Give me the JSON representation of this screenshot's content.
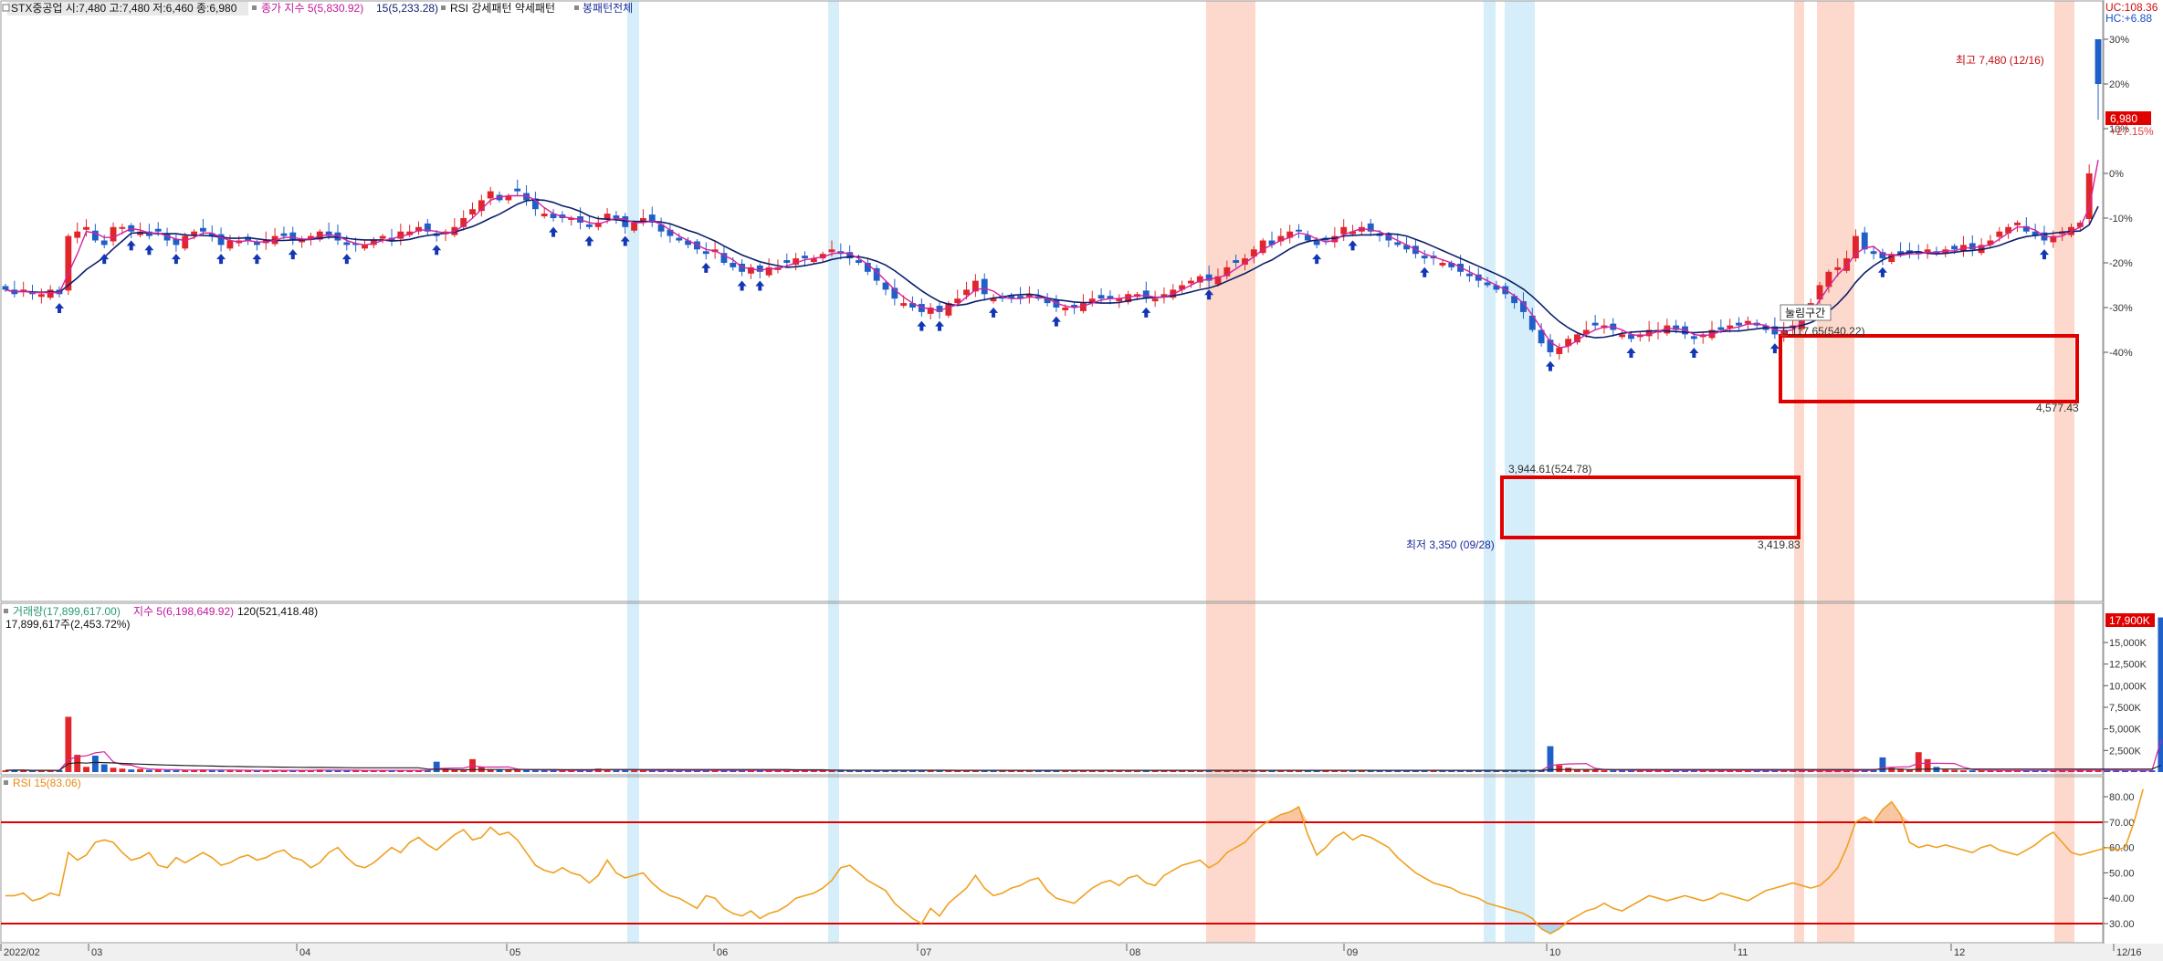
{
  "legend": {
    "price": {
      "stock_info": "STX중공업 시:7,480 고:7,480 저:6,460 종:6,980",
      "ma5": "종가 지수 5(5,830.92)",
      "ma15": "15(5,233.28)",
      "rsi_pattern": "RSI 강세패턴  약세패턴",
      "pattern_all": "봉패턴전체"
    },
    "volume": {
      "volume": "거래량(17,899,617.00)",
      "vma5": "지수 5(6,198,649.92)",
      "vma120": "120(521,418.48)",
      "volume_sub": "17,899,617주(2,453.72%)"
    },
    "rsi": {
      "label": "RSI 15(83.06)"
    }
  },
  "annotations": {
    "high": "최고 7,480 (12/16)",
    "low": "최저 3,350 (09/28)",
    "box2_top": "5,117.65(540.22)",
    "box2_bottom": "4,577.43",
    "box1_top": "3,944.61(524.78)",
    "box1_bottom": "3,419.83",
    "breakout_tag": "눌림구간"
  },
  "right_labels": {
    "uc": "UC:108.36",
    "hc": "HC:+6.88",
    "price": "6,980",
    "price_sub": "+27.15%",
    "volume": "17,900K"
  },
  "colors": {
    "up": "#e0262b",
    "down": "#1f5fc8",
    "ma5": "#d6219e",
    "ma15": "#0c1f6b",
    "rsi": "#f0a020",
    "signal": "#1236b4",
    "band_red": "#fcd9cc",
    "band_blue": "#d5eef9",
    "box": "#e00000"
  },
  "chart_data": {
    "type": "candlestick",
    "ticker": "STX중공업",
    "date_range": [
      "2022/02",
      "12/16"
    ],
    "x_tick_labels": [
      "2022/02",
      "03",
      "04",
      "05",
      "06",
      "07",
      "08",
      "09",
      "10",
      "11",
      "12",
      "12/16"
    ],
    "price_axis_ticks": [
      "30%",
      "20%",
      "10%",
      "0%",
      "-10%",
      "-20%",
      "-30%",
      "-40%"
    ],
    "price_axis_values": [
      30,
      20,
      10,
      0,
      -10,
      -20,
      -30,
      -40
    ],
    "volume_axis_ticks": [
      "15,000K",
      "12,500K",
      "10,000K",
      "7,500K",
      "5,000K",
      "2,500K"
    ],
    "volume_axis_values": [
      15000,
      12500,
      10000,
      7500,
      5000,
      2500
    ],
    "rsi_axis_ticks": [
      "80.00",
      "70.00",
      "60.00",
      "50.00",
      "40.00",
      "30.00"
    ],
    "rsi_axis_values": [
      80,
      70,
      60,
      50,
      40,
      30
    ],
    "rsi_levels": [
      70,
      30
    ],
    "last": {
      "open": 7480,
      "high": 7480,
      "low": 6460,
      "close": 6980,
      "volume": 17899617,
      "rsi": 83.06
    },
    "close_pct": [
      -26,
      -27,
      -26,
      -27,
      -27,
      -26,
      -27,
      -14,
      -13,
      -12,
      -15,
      -16,
      -12,
      -12,
      -13,
      -13,
      -14,
      -13,
      -15,
      -16,
      -14,
      -13,
      -13,
      -14,
      -16,
      -15,
      -15,
      -15,
      -16,
      -15,
      -14,
      -14,
      -15,
      -15,
      -14,
      -13,
      -14,
      -15,
      -16,
      -16,
      -16,
      -15,
      -14,
      -15,
      -13,
      -13,
      -12,
      -13,
      -14,
      -13,
      -12,
      -10,
      -8,
      -6,
      -4,
      -6,
      -5,
      -4,
      -6,
      -8,
      -9,
      -10,
      -10,
      -10,
      -11,
      -12,
      -11,
      -9,
      -10,
      -12,
      -11,
      -10,
      -11,
      -13,
      -14,
      -15,
      -16,
      -17,
      -18,
      -17,
      -20,
      -21,
      -22,
      -21,
      -22,
      -21,
      -21,
      -20,
      -19,
      -19,
      -19,
      -18,
      -17,
      -18,
      -19,
      -20,
      -22,
      -24,
      -26,
      -28,
      -29,
      -30,
      -31,
      -30,
      -31,
      -29,
      -28,
      -26,
      -24,
      -27,
      -28,
      -28,
      -28,
      -28,
      -27,
      -28,
      -29,
      -30,
      -30,
      -30,
      -29,
      -28,
      -28,
      -28,
      -28,
      -27,
      -27,
      -28,
      -28,
      -27,
      -26,
      -25,
      -24,
      -23,
      -24,
      -23,
      -21,
      -20,
      -19,
      -17,
      -15,
      -16,
      -14,
      -13,
      -13,
      -15,
      -16,
      -15,
      -14,
      -12,
      -13,
      -12,
      -13,
      -14,
      -15,
      -16,
      -17,
      -18,
      -19,
      -19,
      -20,
      -21,
      -22,
      -23,
      -24,
      -25,
      -26,
      -27,
      -29,
      -31,
      -35,
      -38,
      -40,
      -39,
      -37,
      -36,
      -35,
      -34,
      -34,
      -35,
      -36,
      -37,
      -36,
      -35,
      -35,
      -34,
      -35,
      -36,
      -37,
      -36,
      -35,
      -35,
      -34,
      -34,
      -33,
      -34,
      -35,
      -36,
      -35,
      -34,
      -31,
      -29,
      -25,
      -22,
      -21,
      -19,
      -14,
      -17,
      -18,
      -19,
      -18,
      -18,
      -18,
      -18,
      -17,
      -18,
      -17,
      -17,
      -16,
      -17,
      -16,
      -15,
      -13,
      -12,
      -11,
      -13,
      -14,
      -15,
      -14,
      -13,
      -12,
      -11,
      0,
      20
    ],
    "high_pct_last": 30,
    "low_pct_last": 12,
    "volume_k": [
      200,
      250,
      200,
      150,
      180,
      200,
      220,
      6400,
      2000,
      600,
      1900,
      900,
      500,
      400,
      300,
      350,
      250,
      300,
      250,
      200,
      200,
      250,
      300,
      250,
      200,
      200,
      200,
      200,
      200,
      200,
      200,
      200,
      200,
      200,
      200,
      300,
      200,
      200,
      200,
      200,
      200,
      200,
      200,
      200,
      200,
      200,
      200,
      200,
      1200,
      400,
      300,
      200,
      1500,
      600,
      300,
      300,
      300,
      250,
      250,
      200,
      200,
      200,
      200,
      200,
      200,
      200,
      400,
      300,
      200,
      200,
      200,
      200,
      200,
      200,
      200,
      200,
      200,
      200,
      200,
      200,
      200,
      200,
      200,
      200,
      200,
      200,
      200,
      200,
      200,
      200,
      200,
      200,
      200,
      200,
      200,
      200,
      200,
      200,
      200,
      200,
      200,
      200,
      200,
      200,
      200,
      200,
      200,
      200,
      200,
      200,
      200,
      200,
      200,
      200,
      200,
      200,
      200,
      200,
      200,
      200,
      200,
      200,
      200,
      200,
      200,
      200,
      200,
      200,
      200,
      200,
      200,
      200,
      200,
      200,
      200,
      200,
      200,
      200,
      200,
      200,
      200,
      200,
      200,
      200,
      200,
      200,
      200,
      200,
      200,
      200,
      200,
      200,
      200,
      200,
      200,
      200,
      200,
      200,
      200,
      200,
      200,
      200,
      200,
      200,
      200,
      200,
      200,
      200,
      200,
      200,
      200,
      200,
      3000,
      800,
      500,
      300,
      300,
      250,
      200,
      200,
      200,
      200,
      200,
      200,
      200,
      200,
      200,
      200,
      200,
      200,
      200,
      200,
      200,
      200,
      200,
      200,
      200,
      200,
      200,
      200,
      200,
      200,
      200,
      200,
      200,
      200,
      200,
      200,
      200,
      1700,
      500,
      400,
      300,
      2300,
      1500,
      600,
      300,
      250,
      200,
      200,
      200,
      200,
      200,
      200,
      200,
      200,
      200,
      200,
      200,
      200,
      200,
      300,
      200,
      200,
      200,
      200,
      200,
      200,
      200,
      200,
      17900
    ],
    "rsi": [
      41,
      41,
      42,
      39,
      40,
      42,
      41,
      58,
      55,
      57,
      62,
      63,
      62,
      58,
      55,
      56,
      58,
      53,
      52,
      56,
      54,
      56,
      58,
      56,
      53,
      54,
      56,
      57,
      55,
      56,
      58,
      59,
      56,
      55,
      52,
      54,
      58,
      60,
      56,
      53,
      52,
      54,
      57,
      60,
      58,
      62,
      64,
      61,
      59,
      62,
      65,
      67,
      63,
      64,
      68,
      65,
      66,
      63,
      58,
      53,
      51,
      50,
      52,
      50,
      49,
      46,
      49,
      55,
      50,
      48,
      49,
      50,
      46,
      43,
      41,
      40,
      38,
      36,
      41,
      40,
      36,
      34,
      33,
      35,
      32,
      34,
      35,
      37,
      40,
      41,
      42,
      44,
      47,
      52,
      53,
      50,
      47,
      45,
      43,
      38,
      35,
      32,
      30,
      36,
      33,
      38,
      41,
      44,
      49,
      44,
      41,
      42,
      44,
      45,
      47,
      48,
      43,
      40,
      39,
      38,
      41,
      44,
      46,
      47,
      45,
      48,
      49,
      46,
      45,
      49,
      51,
      53,
      54,
      55,
      52,
      54,
      58,
      60,
      62,
      66,
      69,
      71,
      73,
      74,
      76,
      65,
      57,
      60,
      64,
      66,
      63,
      65,
      64,
      62,
      60,
      56,
      53,
      50,
      48,
      46,
      45,
      44,
      42,
      41,
      40,
      38,
      37,
      36,
      35,
      34,
      32,
      28,
      26,
      28,
      31,
      33,
      35,
      36,
      38,
      36,
      35,
      37,
      39,
      41,
      40,
      39,
      40,
      41,
      40,
      39,
      40,
      42,
      41,
      40,
      39,
      41,
      43,
      44,
      45,
      46,
      45,
      44,
      45,
      48,
      52,
      60,
      70,
      72,
      70,
      75,
      78,
      73,
      62,
      60,
      61,
      60,
      61,
      60,
      59,
      58,
      60,
      61,
      59,
      58,
      57,
      59,
      61,
      64,
      66,
      62,
      58,
      57,
      58,
      59,
      60,
      59,
      60,
      70,
      83
    ],
    "signals": [
      {
        "type": "rsi_bull",
        "count": 58
      },
      {
        "type": "rsi_bear",
        "count": 0
      }
    ],
    "box_zones": [
      {
        "from_month": "09",
        "to_month": "11",
        "top": 3944.61,
        "bottom": 3419.83
      },
      {
        "from_month": "11",
        "to_month": "12",
        "top": 5117.65,
        "bottom": 4577.43
      }
    ]
  }
}
